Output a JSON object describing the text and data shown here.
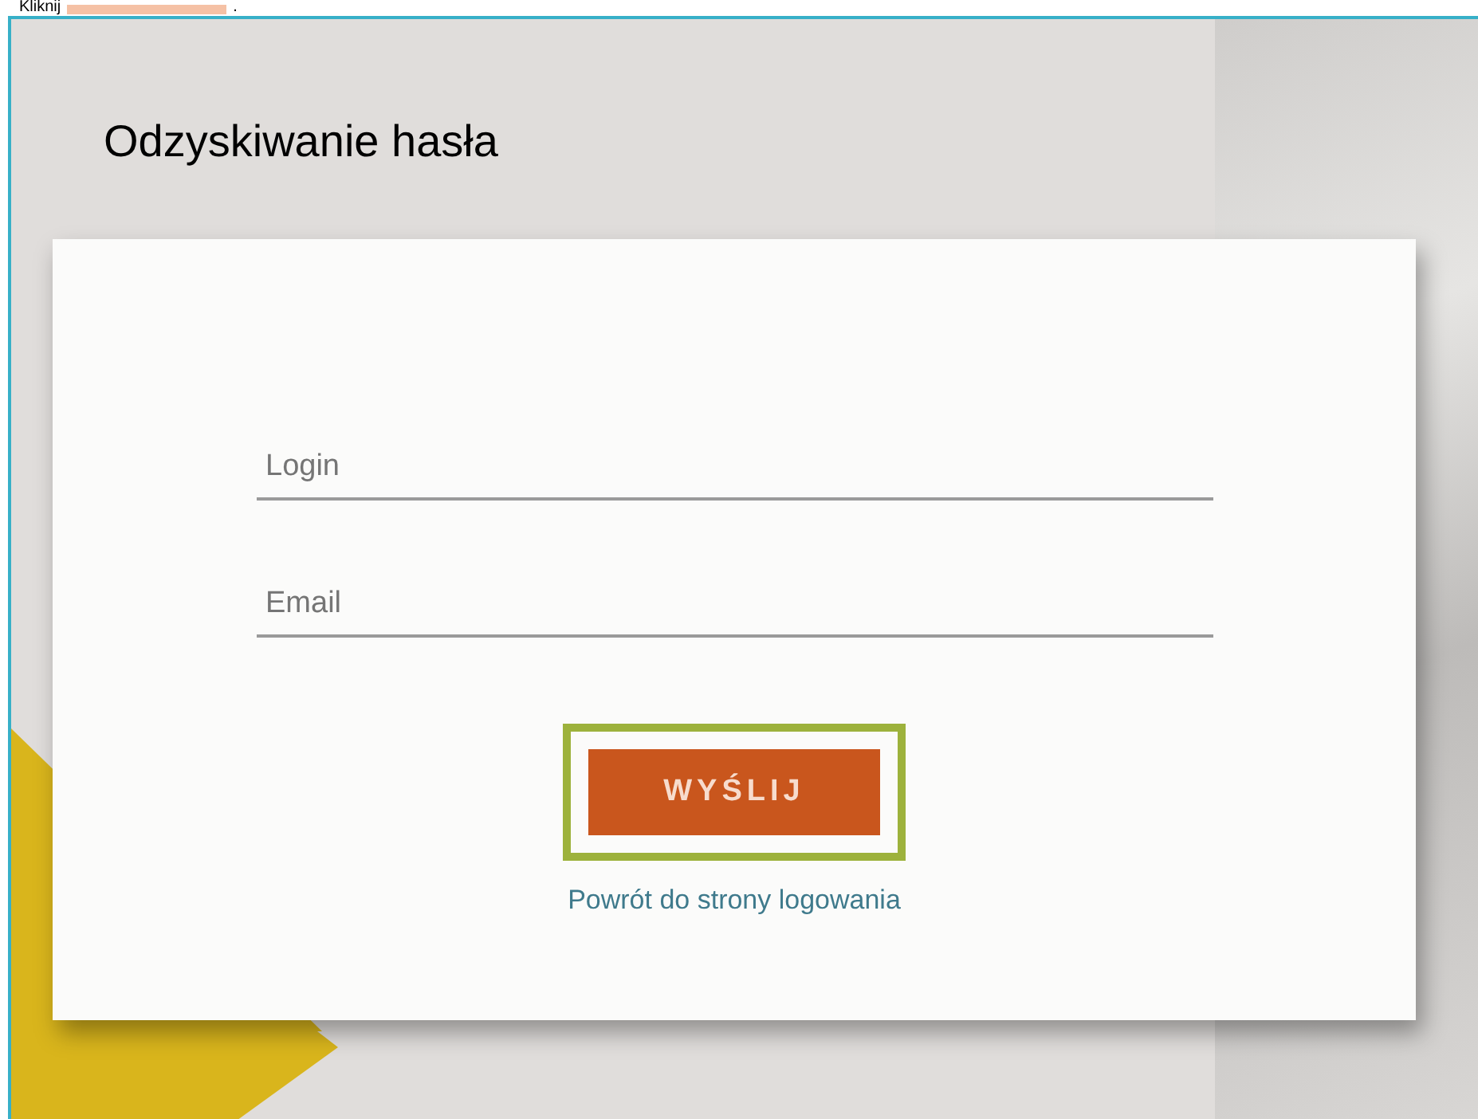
{
  "instruction": {
    "text": "Kliknij",
    "end": "."
  },
  "page": {
    "title": "Odzyskiwanie hasła"
  },
  "form": {
    "fields": [
      {
        "placeholder": "Login"
      },
      {
        "placeholder": "Email"
      }
    ],
    "submit": {
      "label": "WYŚLIJ",
      "highlighted": true
    },
    "link": "Powrót do strony logowania"
  }
}
